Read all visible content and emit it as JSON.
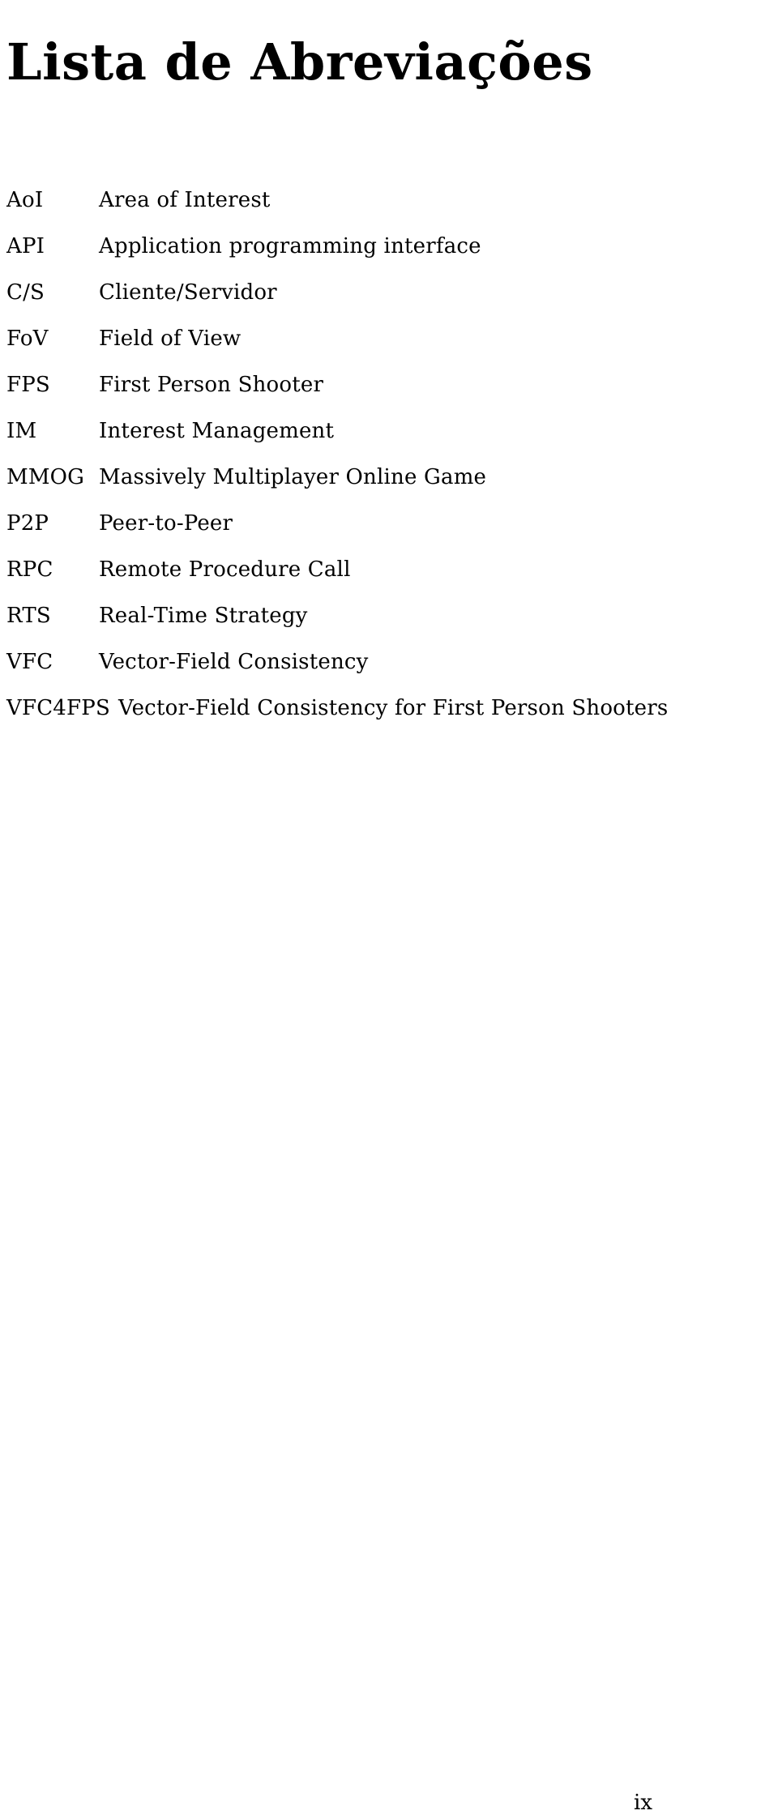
{
  "document": {
    "title": "Lista de Abreviações",
    "page_number": "ix"
  },
  "abbreviations": [
    {
      "term": "AoI",
      "definition": "Area of Interest"
    },
    {
      "term": "API",
      "definition": "Application programming interface"
    },
    {
      "term": "C/S",
      "definition": "Cliente/Servidor"
    },
    {
      "term": "FoV",
      "definition": "Field of View"
    },
    {
      "term": "FPS",
      "definition": "First Person Shooter"
    },
    {
      "term": "IM",
      "definition": "Interest Management"
    },
    {
      "term": "MMOG",
      "definition": "Massively Multiplayer Online Game"
    },
    {
      "term": "P2P",
      "definition": "Peer-to-Peer"
    },
    {
      "term": "RPC",
      "definition": "Remote Procedure Call"
    },
    {
      "term": "RTS",
      "definition": "Real-Time Strategy"
    },
    {
      "term": "VFC",
      "definition": "Vector-Field Consistency"
    },
    {
      "term": "VFC4FPS",
      "definition": "Vector-Field Consistency for First Person Shooters"
    }
  ],
  "colors": {
    "page_background": "#ffffff",
    "text": "#000000"
  }
}
